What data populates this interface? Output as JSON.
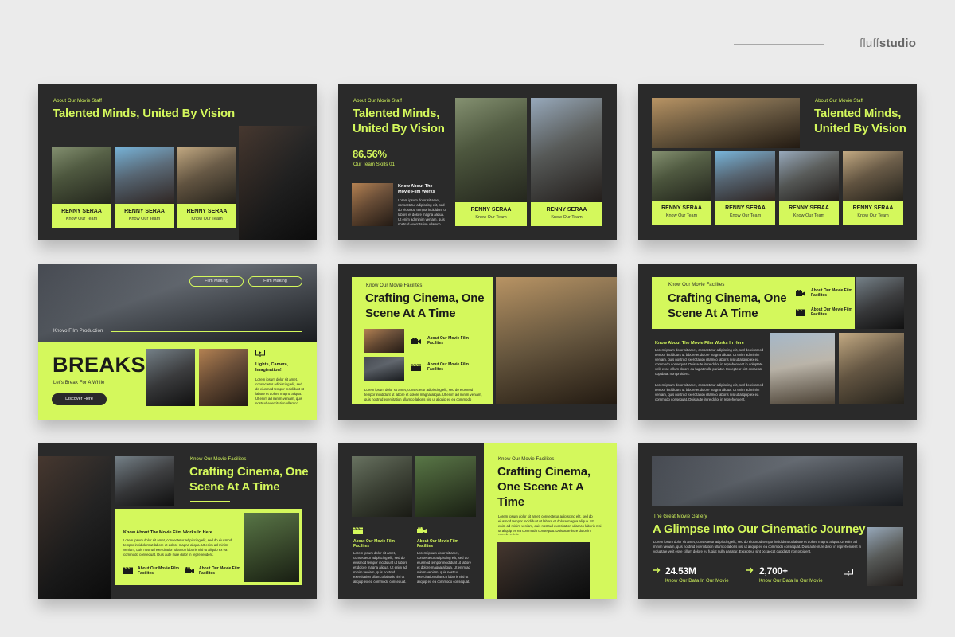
{
  "brand": {
    "light": "fluff",
    "bold": "studio"
  },
  "colors": {
    "accent": "#d4f85c",
    "slide_bg": "#2a2a2a",
    "page_bg": "#ebebeb"
  },
  "lorem_short": "Lorem ipsum dolor sit amet, consectetur adipiscing elit, sed do eiusmod tempor incididunt ut labore et dolore magna aliqua. Ut enim ad minim veniam, quis nostrud exercitation ullamco laboris nisi ut aliquip ex ea commodo consequat. Duis aute irure dolor in reprehenderit.",
  "lorem_long": "Lorem ipsum dolor sit amet, consectetur adipiscing elit, sed do eiusmod tempor incididunt ut labore et dolore magna aliqua. Ut enim ad minim veniam, quis nostrud exercitation ullamco laboris nisi ut aliquip ex ea commodo consequat. Duis aute irure dolor in reprehenderit in voluptate velit esse cillum dolore eu fugiat nulla pariatur. Excepteur sint occaecat cupidatat non proident.",
  "s1": {
    "eyebrow": "About Our Movie Staff",
    "title": "Talented Minds, United By Vision",
    "name": "RENNY SERAA",
    "sub": "Know Our Team"
  },
  "s2": {
    "eyebrow": "About Our Movie Staff",
    "title": "Talented Minds, United By Vision",
    "stat": "86.56%",
    "stat_label": "Our Team Skills 01",
    "know": "Know About The Movie Film Works",
    "name": "RENNY SERAA",
    "sub": "Know Our Team"
  },
  "s3": {
    "eyebrow": "About Our Movie Staff",
    "title": "Talented Minds, United By Vision",
    "name": "RENNY SERAA",
    "sub": "Know Our Team"
  },
  "s4": {
    "pill1": "Film Making",
    "pill2": "Film Making",
    "eyebrow": "Knovo Film Production",
    "title": "BREAKS",
    "sub": "Let's Break For A While",
    "button": "Discover Here",
    "feature": "Lights, Camera, Imagination!"
  },
  "s5": {
    "eyebrow": "Know Our Movie Facilites",
    "title": "Crafting Cinema, One Scene At A Time",
    "f1": "About Our Movie Film Facilites",
    "f2": "About Our Movie Film Facilites"
  },
  "s6": {
    "eyebrow": "Know Our Movie Facilites",
    "title": "Crafting Cinema, One Scene At A Time",
    "f1": "About Our Movie Film Facilites",
    "f2": "About Our Movie Film Facilites",
    "know": "Know About The Movie Film Works In Here"
  },
  "s7": {
    "eyebrow": "Know Our Movie Facilites",
    "title": "Crafting Cinema, One Scene At A Time",
    "know": "Know About The Movie Film Works In Here",
    "f1": "About Our Movie Film Facilites",
    "f2": "About Our Movie Film Facilites"
  },
  "s8": {
    "eyebrow": "Know Our Movie Facilites",
    "title": "Crafting Cinema, One Scene At A Time",
    "f1": "About Our Movie Film Facilites",
    "f2": "About Our Movie Film Facilites"
  },
  "s9": {
    "eyebrow": "The Great Movie Gallery",
    "title": "A Glimpse Into Our Cinematic Journey",
    "stat1": "24.53M",
    "stat1_label": "Know Our Data In Our Movie",
    "stat2": "2,700+",
    "stat2_label": "Know Our Data In Our Movie"
  }
}
